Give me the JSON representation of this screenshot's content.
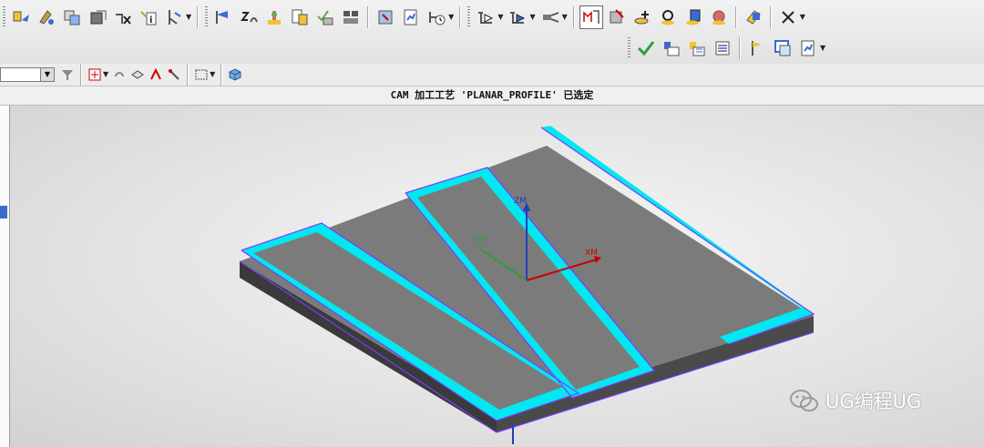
{
  "toolbar": {
    "row1_icons": [
      "create-program-icon",
      "create-tool-icon",
      "create-geometry-icon",
      "create-method-icon",
      "delete-icon",
      "information-icon",
      "filter-icon",
      "edit-object-icon",
      "path-list-icon",
      "verify-icon",
      "post-process-icon",
      "shop-doc-icon",
      "cut-sequence-icon",
      "machine-tool-icon",
      "simulate-icon",
      "display-path-icon",
      "replay-path-icon",
      "feed-icon",
      "show-path-icon",
      "generate-path-icon",
      "tool-manager-icon",
      "translate-icon",
      "rotate-icon",
      "list-icon",
      "output-icon",
      "close-x-icon"
    ],
    "row2_icons": [
      "checkmark-icon",
      "tool-list-icon",
      "multi-tool-icon",
      "cut-list-icon",
      "flag-icon",
      "window-icon",
      "post-icon"
    ]
  },
  "status": {
    "message": "CAM 加工工艺 'PLANAR_PROFILE' 已选定"
  },
  "viewport": {
    "axis_z": "ZM",
    "axis_x": "XM",
    "axis_y": "YM",
    "model_colors": {
      "top": "#7b7b7b",
      "side": "#454545",
      "front": "#3a3a3a",
      "wall": "#00e8f0",
      "path": "#7a3cff"
    }
  },
  "watermark": {
    "text": "UG编程UG"
  }
}
